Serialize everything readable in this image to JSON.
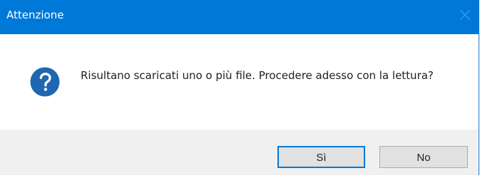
{
  "dialog": {
    "title": "Attenzione",
    "message": "Risultano scaricati uno o più file. Procedere adesso con la lettura?",
    "icon": "question-icon",
    "buttons": {
      "yes": "Sì",
      "no": "No"
    },
    "colors": {
      "titlebar": "#0078d7",
      "footer": "#f0f0f0",
      "button": "#e1e1e1",
      "default_button_border": "#0078d7",
      "icon": "#1f67b0"
    }
  }
}
